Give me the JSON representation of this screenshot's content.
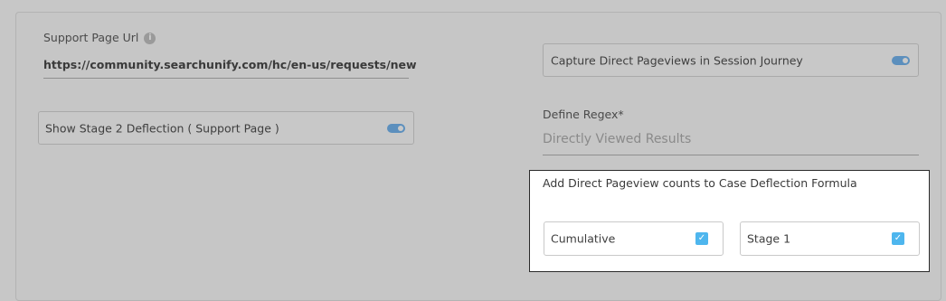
{
  "support_page": {
    "label": "Support Page Url",
    "info_icon": "info-icon",
    "value": "https://community.searchunify.com/hc/en-us/requests/new"
  },
  "capture_direct": {
    "label": "Capture Direct Pageviews in Session Journey",
    "enabled": true
  },
  "stage2": {
    "label": "Show Stage 2 Deflection ( Support Page )",
    "enabled": true
  },
  "regex": {
    "label": "Define Regex*",
    "placeholder": "Directly Viewed Results"
  },
  "formula": {
    "title": "Add Direct Pageview counts to Case Deflection Formula",
    "options": [
      {
        "label": "Cumulative",
        "checked": true
      },
      {
        "label": "Stage 1",
        "checked": true
      }
    ]
  },
  "colors": {
    "toggle_on": "#5c8fbd",
    "checkbox": "#4eb6ee",
    "overlay_bg": "#c7c7c7"
  }
}
